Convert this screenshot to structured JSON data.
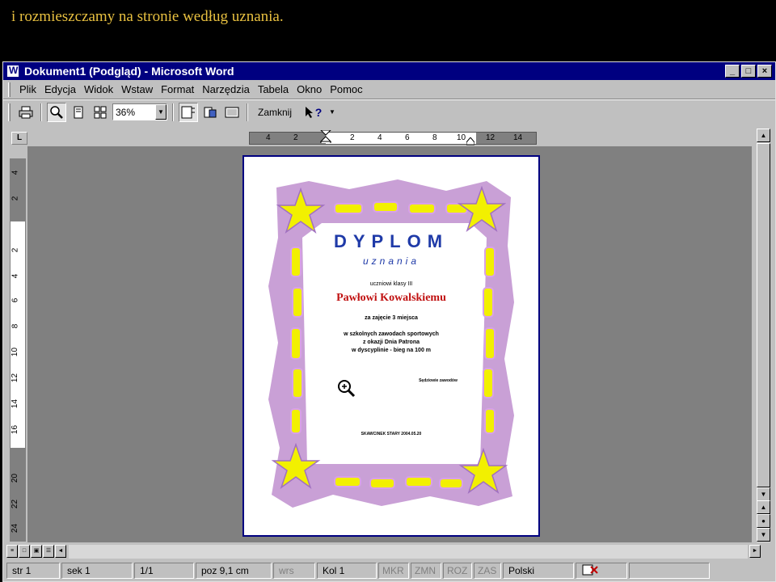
{
  "caption": "i rozmieszczamy na stronie według uznania.",
  "window": {
    "title": "Dokument1 (Podgląd) - Microsoft Word",
    "buttons": [
      "_",
      "□",
      "×"
    ]
  },
  "menu": [
    "Plik",
    "Edycja",
    "Widok",
    "Wstaw",
    "Format",
    "Narzędzia",
    "Tabela",
    "Okno",
    "Pomoc"
  ],
  "toolbar": {
    "zoom": "36%",
    "close_label": "Zamknij",
    "help_label": "?"
  },
  "ruler": {
    "corner": "L",
    "h_ticks": [
      "4",
      "2",
      "2",
      "4",
      "6",
      "8",
      "10",
      "12",
      "14"
    ],
    "v_ticks": [
      "4",
      "2",
      "2",
      "4",
      "6",
      "8",
      "10",
      "12",
      "14",
      "16",
      "20",
      "22",
      "24"
    ]
  },
  "diploma": {
    "title": "DYPLOM",
    "subtitle": "uznania",
    "line1": "uczniowi klasy III",
    "name": "Pawłowi Kowalskiemu",
    "line2": "za zajęcie 3 miejsca",
    "line3": "w szkolnych zawodach sportowych",
    "line4": "z okazji Dnia Patrona",
    "line5": "w dyscyplinie - bieg na 100 m",
    "signature": "Sędziowie zawodów",
    "footer": "SKAWCINEK STARY 2004.05.20"
  },
  "statusbar": {
    "page": "str 1",
    "section": "sek 1",
    "pages": "1/1",
    "position": "poz 9,1 cm",
    "row": "wrs",
    "col": "Kol 1",
    "mkr": "MKR",
    "zmn": "ZMN",
    "roz": "ROZ",
    "zas": "ZAS",
    "language": "Polski"
  }
}
